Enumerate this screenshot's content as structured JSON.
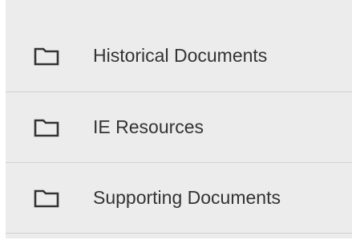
{
  "folders": {
    "items": [
      {
        "label": "Historical Documents",
        "icon": "folder-icon"
      },
      {
        "label": "IE Resources",
        "icon": "folder-icon"
      },
      {
        "label": "Supporting Documents",
        "icon": "folder-icon"
      }
    ]
  },
  "colors": {
    "panel_background": "#ececec",
    "divider": "#d2d2d2",
    "text": "#333333",
    "icon_stroke": "#333333"
  }
}
